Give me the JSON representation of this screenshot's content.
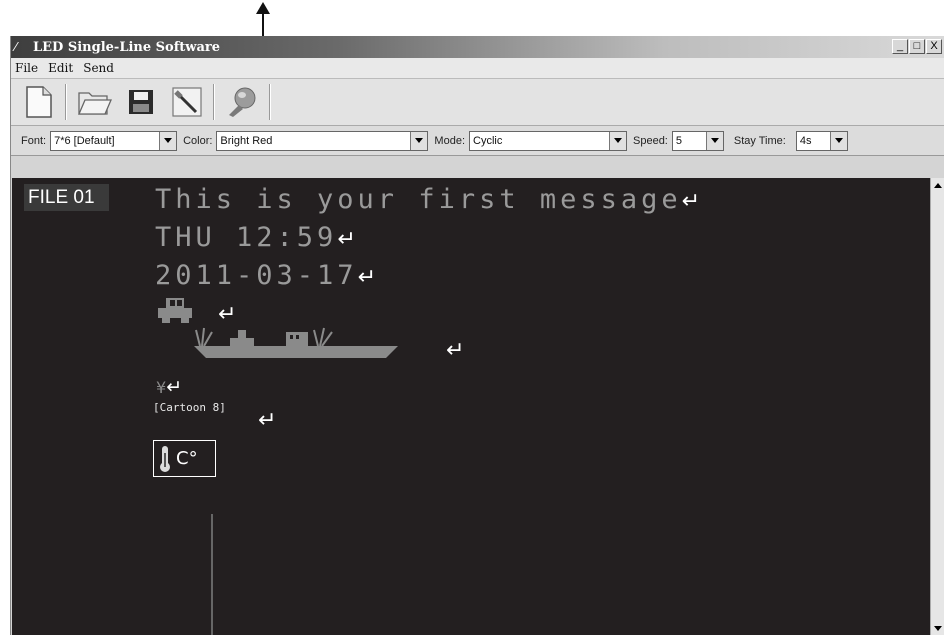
{
  "window": {
    "title": "LED Single-Line Software",
    "controls": {
      "minimize": "_",
      "maximize": "□",
      "close": "X"
    }
  },
  "menu": [
    "File",
    "Edit",
    "Send"
  ],
  "toolbar": {
    "buttons": [
      {
        "name": "new",
        "icon": "new-file-icon"
      },
      {
        "name": "open",
        "icon": "open-folder-icon"
      },
      {
        "name": "save",
        "icon": "floppy-disk-icon"
      },
      {
        "name": "settings",
        "icon": "screwdriver-icon"
      },
      {
        "name": "send",
        "icon": "send-globe-icon"
      }
    ]
  },
  "options": {
    "font_label": "Font:",
    "font_value": "7*6 [Default]",
    "color_label": "Color:",
    "color_value": "Bright Red",
    "mode_label": "Mode:",
    "mode_value": "Cyclic",
    "speed_label": "Speed:",
    "speed_value": "5",
    "stay_label": "Stay Time:",
    "stay_value": "4s"
  },
  "editor": {
    "file_label": "FILE 01",
    "lines": [
      "This is your first message",
      "THU 12:59",
      "2011-03-17"
    ],
    "return_glyph": "↵",
    "yen_glyph": "¥",
    "cartoon_label": "[Cartoon 8]",
    "temperature_unit": "C°"
  },
  "colors": {
    "editor_bg": "#231f20",
    "led_text": "#9a9a9a",
    "chrome": "#d4d4d4"
  }
}
